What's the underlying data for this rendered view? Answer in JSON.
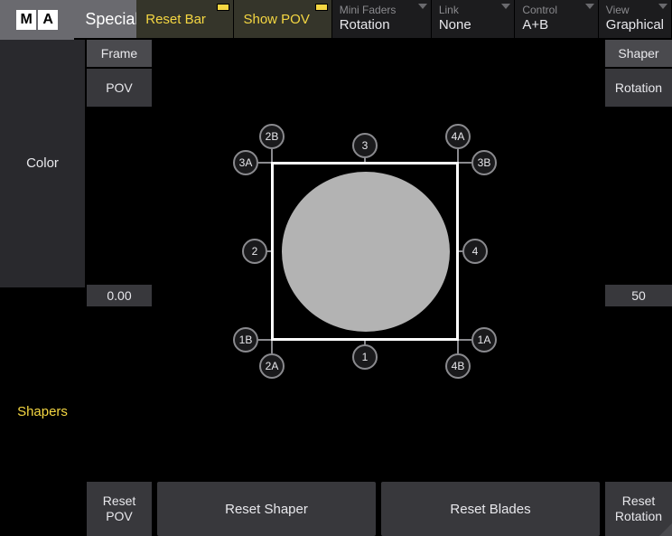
{
  "logo": {
    "m": "M",
    "a": "A"
  },
  "title": "Special",
  "topbar": {
    "reset_bar": "Reset Bar",
    "show_pov": "Show POV",
    "dropdowns": [
      {
        "label": "Mini Faders",
        "value": "Rotation"
      },
      {
        "label": "Link",
        "value": "None"
      },
      {
        "label": "Control",
        "value": "A+B"
      },
      {
        "label": "View",
        "value": "Graphical"
      }
    ]
  },
  "sidebar": {
    "items": [
      "Color",
      "Shapers"
    ]
  },
  "left_column": {
    "header": "Frame",
    "sub": "POV",
    "value": "0.00",
    "reset_button_l1": "Reset",
    "reset_button_l2": "POV"
  },
  "right_column": {
    "header": "Shaper",
    "sub": "Rotation",
    "value": "50",
    "reset_button_l1": "Reset",
    "reset_button_l2": "Rotation"
  },
  "center": {
    "reset_shaper": "Reset Shaper",
    "reset_blades": "Reset Blades"
  },
  "handles": {
    "n1": "1",
    "n1a": "1A",
    "n1b": "1B",
    "n2": "2",
    "n2a": "2A",
    "n2b": "2B",
    "n3": "3",
    "n3a": "3A",
    "n3b": "3B",
    "n4": "4",
    "n4a": "4A",
    "n4b": "4B"
  }
}
